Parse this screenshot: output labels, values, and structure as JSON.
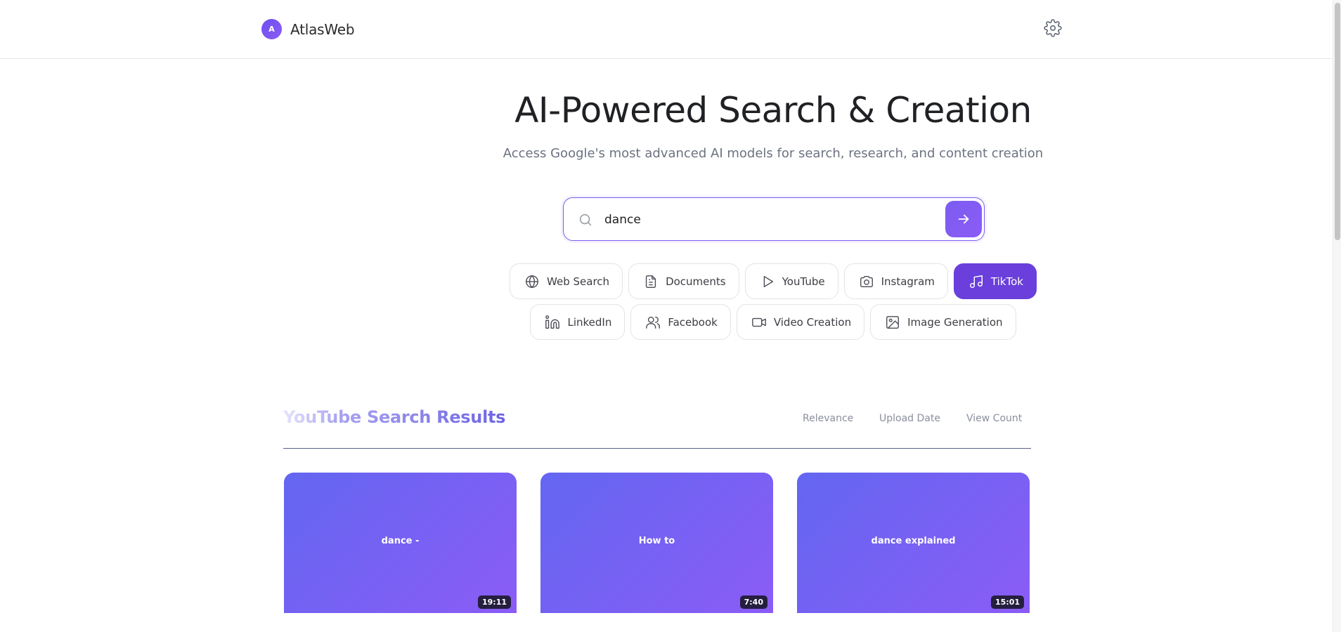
{
  "app": {
    "avatar_letter": "A",
    "name": "AtlasWeb"
  },
  "hero": {
    "title": "AI-Powered Search & Creation",
    "subtitle": "Access Google's most advanced AI models for search, research, and content creation"
  },
  "search": {
    "value": "dance",
    "placeholder": ""
  },
  "chips": [
    {
      "label": "Web Search",
      "icon": "globe-icon",
      "active": false
    },
    {
      "label": "Documents",
      "icon": "document-icon",
      "active": false
    },
    {
      "label": "YouTube",
      "icon": "play-icon",
      "active": false
    },
    {
      "label": "Instagram",
      "icon": "camera-icon",
      "active": false
    },
    {
      "label": "TikTok",
      "icon": "music-icon",
      "active": true
    },
    {
      "label": "LinkedIn",
      "icon": "linkedin-icon",
      "active": false
    },
    {
      "label": "Facebook",
      "icon": "users-icon",
      "active": false
    },
    {
      "label": "Video Creation",
      "icon": "video-icon",
      "active": false
    },
    {
      "label": "Image Generation",
      "icon": "image-icon",
      "active": false
    }
  ],
  "results": {
    "title": "YouTube Search Results",
    "sort_options": [
      "Relevance",
      "Upload Date",
      "View Count"
    ]
  },
  "videos": [
    {
      "label": "dance -",
      "duration": "19:11"
    },
    {
      "label": "How to",
      "duration": "7:40"
    },
    {
      "label": "dance explained",
      "duration": "15:01"
    }
  ],
  "colors": {
    "accent": "#6a3fdb",
    "gradient_start": "#6366f1",
    "gradient_end": "#8b5cf6"
  }
}
